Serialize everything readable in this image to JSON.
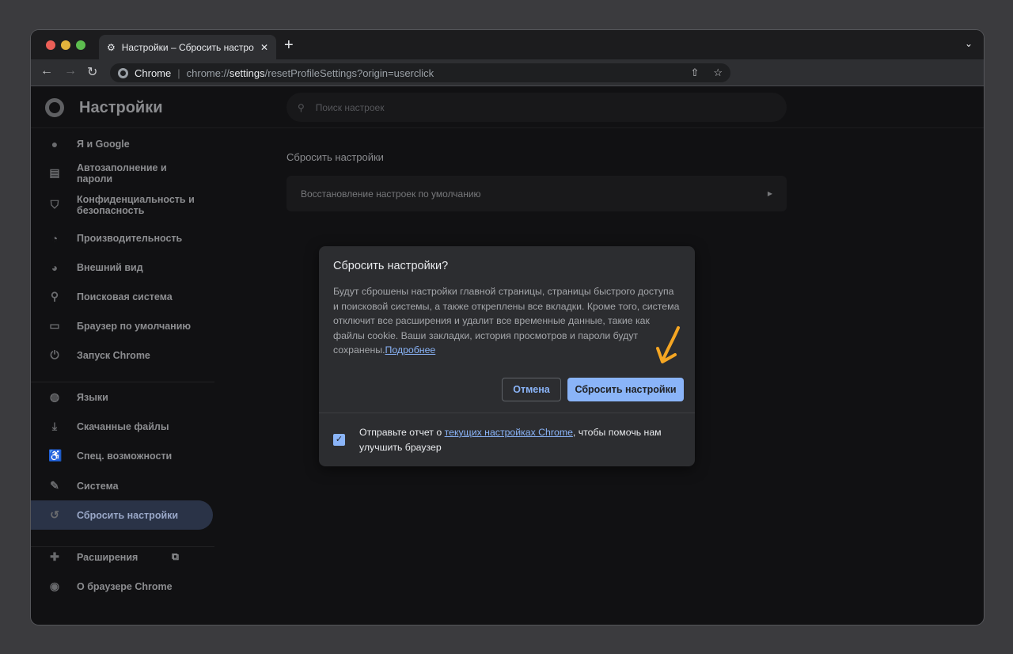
{
  "tab": {
    "title": "Настройки – Сбросить настройки",
    "new_tab": "+",
    "close": "✕"
  },
  "toolbar": {
    "site_label": "Chrome",
    "url_prefix": "chrome://",
    "url_host": "settings",
    "url_path": "/resetProfileSettings?origin=userclick"
  },
  "header": {
    "title": "Настройки",
    "search_placeholder": "Поиск настроек"
  },
  "sidebar": {
    "items": [
      {
        "label": "Я и Google",
        "icon": "person-icon"
      },
      {
        "label": "Автозаполнение и пароли",
        "icon": "clipboard-icon"
      },
      {
        "label": "Конфиденциальность и безопасность",
        "icon": "shield-icon"
      },
      {
        "label": "Производительность",
        "icon": "speedometer-icon"
      },
      {
        "label": "Внешний вид",
        "icon": "palette-icon"
      },
      {
        "label": "Поисковая система",
        "icon": "search-icon"
      },
      {
        "label": "Браузер по умолчанию",
        "icon": "browser-icon"
      },
      {
        "label": "Запуск Chrome",
        "icon": "power-icon"
      },
      {
        "label": "Языки",
        "icon": "globe-icon"
      },
      {
        "label": "Скачанные файлы",
        "icon": "download-icon"
      },
      {
        "label": "Спец. возможности",
        "icon": "accessibility-icon"
      },
      {
        "label": "Система",
        "icon": "wrench-icon"
      },
      {
        "label": "Сбросить настройки",
        "icon": "history-icon",
        "selected": true
      },
      {
        "label": "Расширения",
        "icon": "puzzle-icon"
      },
      {
        "label": "О браузере Chrome",
        "icon": "chrome-icon"
      }
    ]
  },
  "main": {
    "section_title": "Сбросить настройки",
    "card_label": "Восстановление настроек по умолчанию"
  },
  "dialog": {
    "title": "Сбросить настройки?",
    "body": "Будут сброшены настройки главной страницы, страницы быстрого доступа и поисковой системы, а также откреплены все вкладки. Кроме того, система отключит все расширения и удалит все временные данные, такие как файлы cookie. Ваши закладки, история просмотров и пароли будут сохранены.",
    "learn_more": "Подробнее",
    "cancel": "Отмена",
    "confirm": "Сбросить настройки",
    "report_prefix": "Отправьте отчет о ",
    "report_link": "текущих настройках Chrome",
    "report_suffix": ", чтобы помочь нам улучшить браузер",
    "report_checked": true
  },
  "colors": {
    "accent": "#8ab4f8",
    "annotation_arrow": "#f5a623"
  }
}
